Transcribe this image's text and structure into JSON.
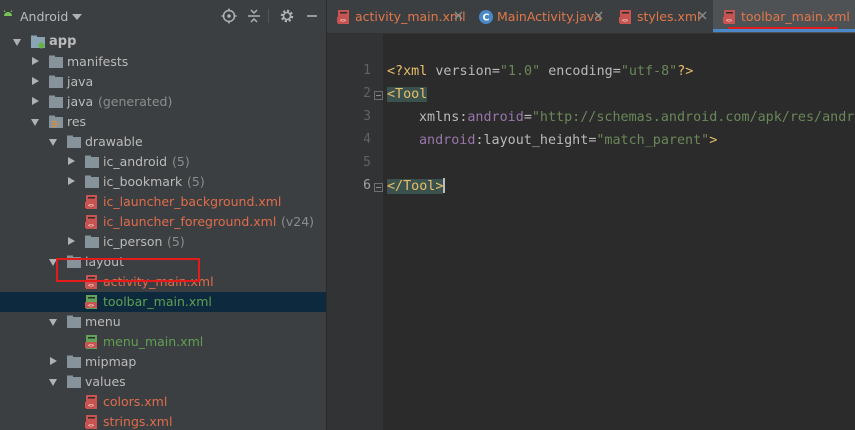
{
  "project_panel": {
    "view_selector": "Android"
  },
  "tree": [
    {
      "label": "app",
      "kind": "module",
      "expanded": true,
      "depth": 0,
      "bold": true
    },
    {
      "label": "manifests",
      "kind": "folder",
      "expanded": false,
      "depth": 1
    },
    {
      "label": "java",
      "kind": "folder",
      "expanded": false,
      "depth": 1
    },
    {
      "label": "java",
      "suffix": "(generated)",
      "kind": "folder",
      "expanded": false,
      "depth": 1
    },
    {
      "label": "res",
      "kind": "res-folder",
      "expanded": true,
      "depth": 1
    },
    {
      "label": "drawable",
      "kind": "folder",
      "expanded": true,
      "depth": 2
    },
    {
      "label": "ic_android",
      "suffix": "(5)",
      "kind": "folder",
      "expanded": false,
      "depth": 3
    },
    {
      "label": "ic_bookmark",
      "suffix": "(5)",
      "kind": "folder",
      "expanded": false,
      "depth": 3
    },
    {
      "label": "ic_launcher_background.xml",
      "kind": "xml-red",
      "depth": 3
    },
    {
      "label": "ic_launcher_foreground.xml",
      "suffix": "(v24)",
      "kind": "xml-red",
      "depth": 3
    },
    {
      "label": "ic_person",
      "suffix": "(5)",
      "kind": "folder",
      "expanded": false,
      "depth": 3
    },
    {
      "label": "layout",
      "kind": "folder",
      "expanded": true,
      "depth": 2
    },
    {
      "label": "activity_main.xml",
      "kind": "xml-red",
      "depth": 3
    },
    {
      "label": "toolbar_main.xml",
      "kind": "xml-green",
      "depth": 3,
      "selected": true
    },
    {
      "label": "menu",
      "kind": "folder",
      "expanded": true,
      "depth": 2
    },
    {
      "label": "menu_main.xml",
      "kind": "xml-green",
      "depth": 3
    },
    {
      "label": "mipmap",
      "kind": "folder",
      "expanded": false,
      "depth": 2
    },
    {
      "label": "values",
      "kind": "folder",
      "expanded": true,
      "depth": 2
    },
    {
      "label": "colors.xml",
      "kind": "xml-red",
      "depth": 3
    },
    {
      "label": "strings.xml",
      "kind": "xml-red",
      "depth": 3
    }
  ],
  "tabs": [
    {
      "label": "activity_main.xml",
      "kind": "xml"
    },
    {
      "label": "MainActivity.java",
      "kind": "java"
    },
    {
      "label": "styles.xml",
      "kind": "xml"
    },
    {
      "label": "toolbar_main.xml",
      "kind": "xml",
      "active": true
    }
  ],
  "editor": {
    "line_numbers": [
      "1",
      "2",
      "3",
      "4",
      "5",
      "6"
    ],
    "current_line": "6",
    "lines": {
      "l1": {
        "decl": "<?xml ",
        "a1": "version",
        "eq1": "=",
        "v1": "\"1.0\"",
        "sp": " ",
        "a2": "encoding",
        "eq2": "=",
        "v2": "\"utf-8\"",
        "end": "?>"
      },
      "l2": {
        "tag": "<Tool"
      },
      "l3": {
        "ns": "xmlns",
        "colon": ":",
        "nsname": "android",
        "eq": "=",
        "val": "\"http://schemas.android.com/apk/res/android\""
      },
      "l4": {
        "ns": "android",
        "colon": ":",
        "attr": "layout_height",
        "eq": "=",
        "val": "\"match_parent\"",
        "end": ">"
      },
      "l6": {
        "tag": "</Tool",
        "end": ">"
      }
    }
  },
  "colors": {
    "highlight_border": "#e31b1b",
    "selection_bg": "#0d293e",
    "active_tab_accent": "#4a88c7"
  }
}
